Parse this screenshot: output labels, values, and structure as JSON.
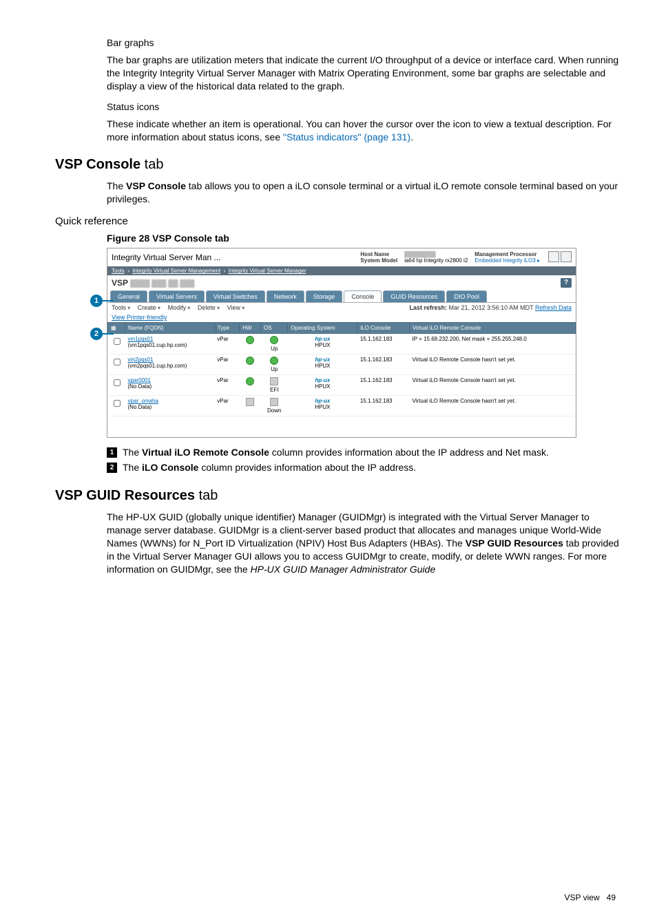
{
  "subheading_bar": "Bar graphs",
  "para_bar": "The bar graphs are utilization meters that indicate the current I/O throughput of a device or interface card. When running the Integrity Integrity Virtual Server Manager with Matrix Operating Environment, some bar graphs are selectable and display a view of the historical data related to the graph.",
  "subheading_status": "Status icons",
  "para_status_a": "These indicate whether an item is operational. You can hover the cursor over the icon to view a textual description. For more information about status icons, see ",
  "para_status_link": "\"Status indicators\" (page 131)",
  "para_status_b": ".",
  "h_vspconsole": "VSP Console",
  "h_vspconsole_tab": " tab",
  "para_vspconsole_a": "The ",
  "para_vspconsole_b": "VSP Console",
  "para_vspconsole_c": " tab allows you to open a iLO console terminal or a virtual iLO remote console terminal based on your privileges.",
  "quickref": "Quick reference",
  "figcap": "Figure 28 VSP Console tab",
  "shot": {
    "title": "Integrity Virtual Server Man ...",
    "hostname_lbl": "Host Name",
    "sysmodel_lbl": "System Model",
    "sysmodel_val": "ia64 hp Integrity rx2800 i2",
    "mp_lbl": "Management Processor",
    "mp_val": "Embedded Integrity iLO3 ▸",
    "crumb_a": "Tools",
    "crumb_b": "Integrity Virtual Server Management",
    "crumb_c": "Integrity Virtual Server Manager",
    "vsp": "VSP",
    "help": "?",
    "tabs": {
      "general": "General",
      "virtual_servers": "Virtual Servers",
      "virtual_switches": "Virtual Switches",
      "network": "Network",
      "storage": "Storage",
      "console": "Console",
      "guid": "GUID Resources",
      "dio": "DIO Pool"
    },
    "menus": {
      "tools": "Tools",
      "create": "Create",
      "modify": "Modify",
      "delete": "Delete",
      "view": "View"
    },
    "refresh_lbl": "Last refresh:",
    "refresh_ts": "Mar 21, 2012 3:56:10 AM MDT",
    "refresh_link": "Refresh Data",
    "printer_friendly": "View Printer-friendly",
    "cols": {
      "name": "Name (FQDN)",
      "type": "Type",
      "hw": "HW",
      "os": "OS",
      "opsys": "Operating System",
      "ilo": "iLO Console",
      "virtilo": "Virtual iLO Remote Console"
    },
    "rows": [
      {
        "name": "vm1pqs01",
        "fqdn": "(vm1pqs01.cup.hp.com)",
        "type": "vPar",
        "hw": "ok",
        "os": "ok",
        "os_lbl": "Up",
        "opsys": "HPUX",
        "ilo": "15.1.162.183",
        "virtilo": "IP = 15.69.232.200, Net mask = 255.255.248.0"
      },
      {
        "name": "vm2pqs01",
        "fqdn": "(vm2pqs01.cup.hp.com)",
        "type": "vPar",
        "hw": "ok",
        "os": "ok",
        "os_lbl": "Up",
        "opsys": "HPUX",
        "ilo": "15.1.162.183",
        "virtilo": "Virtual iLO Remote Console hasn't set yet."
      },
      {
        "name": "vpar0001",
        "fqdn": "(No Data)",
        "type": "vPar",
        "hw": "ok",
        "os": "unk",
        "os_lbl": "EFI",
        "opsys": "HPUX",
        "ilo": "15.1.162.183",
        "virtilo": "Virtual iLO Remote Console hasn't set yet."
      },
      {
        "name": "vpar_omaha",
        "fqdn": "(No Data)",
        "type": "vPar",
        "hw": "unk",
        "os": "unk",
        "os_lbl": "Down",
        "opsys": "HPUX",
        "ilo": "15.1.162.183",
        "virtilo": "Virtual iLO Remote Console hasn't set yet."
      }
    ]
  },
  "callout1_n": "1",
  "callout2_n": "2",
  "list1_a": "The ",
  "list1_b": "Virtual iLO Remote Console",
  "list1_c": " column provides information about the IP address and Net mask.",
  "list2_a": "The ",
  "list2_b": "iLO Console",
  "list2_c": " column provides information about the IP address.",
  "h_guid": "VSP GUID Resources",
  "h_guid_tab": " tab",
  "para_guid_a": "The HP-UX GUID (globally unique identifier) Manager (GUIDMgr) is integrated with the Virtual Server Manager to manage server database. GUIDMgr is a client-server based product that allocates and manages unique World-Wide Names (WWNs) for N_Port ID Virtualization (NPIV) Host Bus Adapters (HBAs). The ",
  "para_guid_b": "VSP GUID Resources",
  "para_guid_c": " tab provided in the Virtual Server Manager GUI allows you to access GUIDMgr to create, modify, or delete WWN ranges. For more information on GUIDMgr, see the ",
  "para_guid_d": "HP-UX GUID Manager Administrator Guide",
  "footer_label": "VSP view",
  "footer_page": "49"
}
